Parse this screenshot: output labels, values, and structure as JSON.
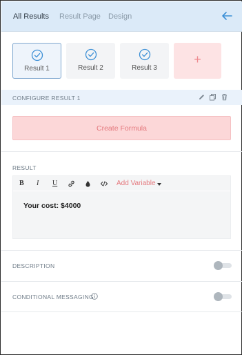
{
  "header": {
    "tabs": [
      {
        "label": "All Results",
        "active": true
      },
      {
        "label": "Result Page",
        "active": false
      },
      {
        "label": "Design",
        "active": false
      }
    ],
    "back_icon": "arrow-left-icon"
  },
  "results": {
    "cards": [
      {
        "label": "Result 1",
        "selected": true
      },
      {
        "label": "Result 2",
        "selected": false
      },
      {
        "label": "Result 3",
        "selected": false
      }
    ],
    "add_label": "+"
  },
  "configure": {
    "title": "CONFIGURE RESULT 1",
    "icons": [
      "pencil-icon",
      "copy-icon",
      "trash-icon"
    ]
  },
  "formula": {
    "button_label": "Create Formula"
  },
  "result_section": {
    "label": "RESULT",
    "toolbar": {
      "bold": "B",
      "italic": "I",
      "underline": "U",
      "add_variable": "Add Variable"
    },
    "content": "Your cost: $4000"
  },
  "description": {
    "label": "DESCRIPTION",
    "enabled": false
  },
  "conditional": {
    "label": "CONDITIONAL MESSAGING",
    "enabled": false
  },
  "colors": {
    "accent_blue": "#3b8fd6",
    "accent_red": "#e4787d",
    "header_bg": "#dbeaf8",
    "add_bg": "#fde3e4"
  }
}
